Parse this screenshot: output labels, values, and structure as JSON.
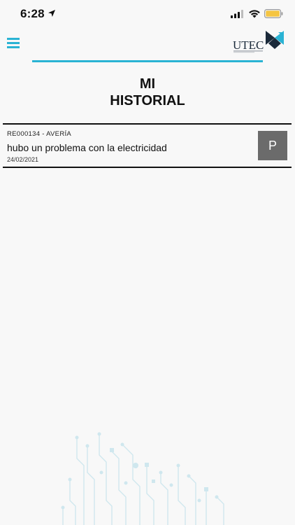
{
  "status_bar": {
    "time": "6:28"
  },
  "header": {
    "logo_text": "UTEC",
    "accent_color": "#2ab3d4"
  },
  "page": {
    "title_line1": "MI",
    "title_line2": "HISTORIAL"
  },
  "history": [
    {
      "code": "RE000134 - AVERÍA",
      "description": "hubo un problema con la electricidad",
      "date": "24/02/2021",
      "status": "P"
    }
  ]
}
